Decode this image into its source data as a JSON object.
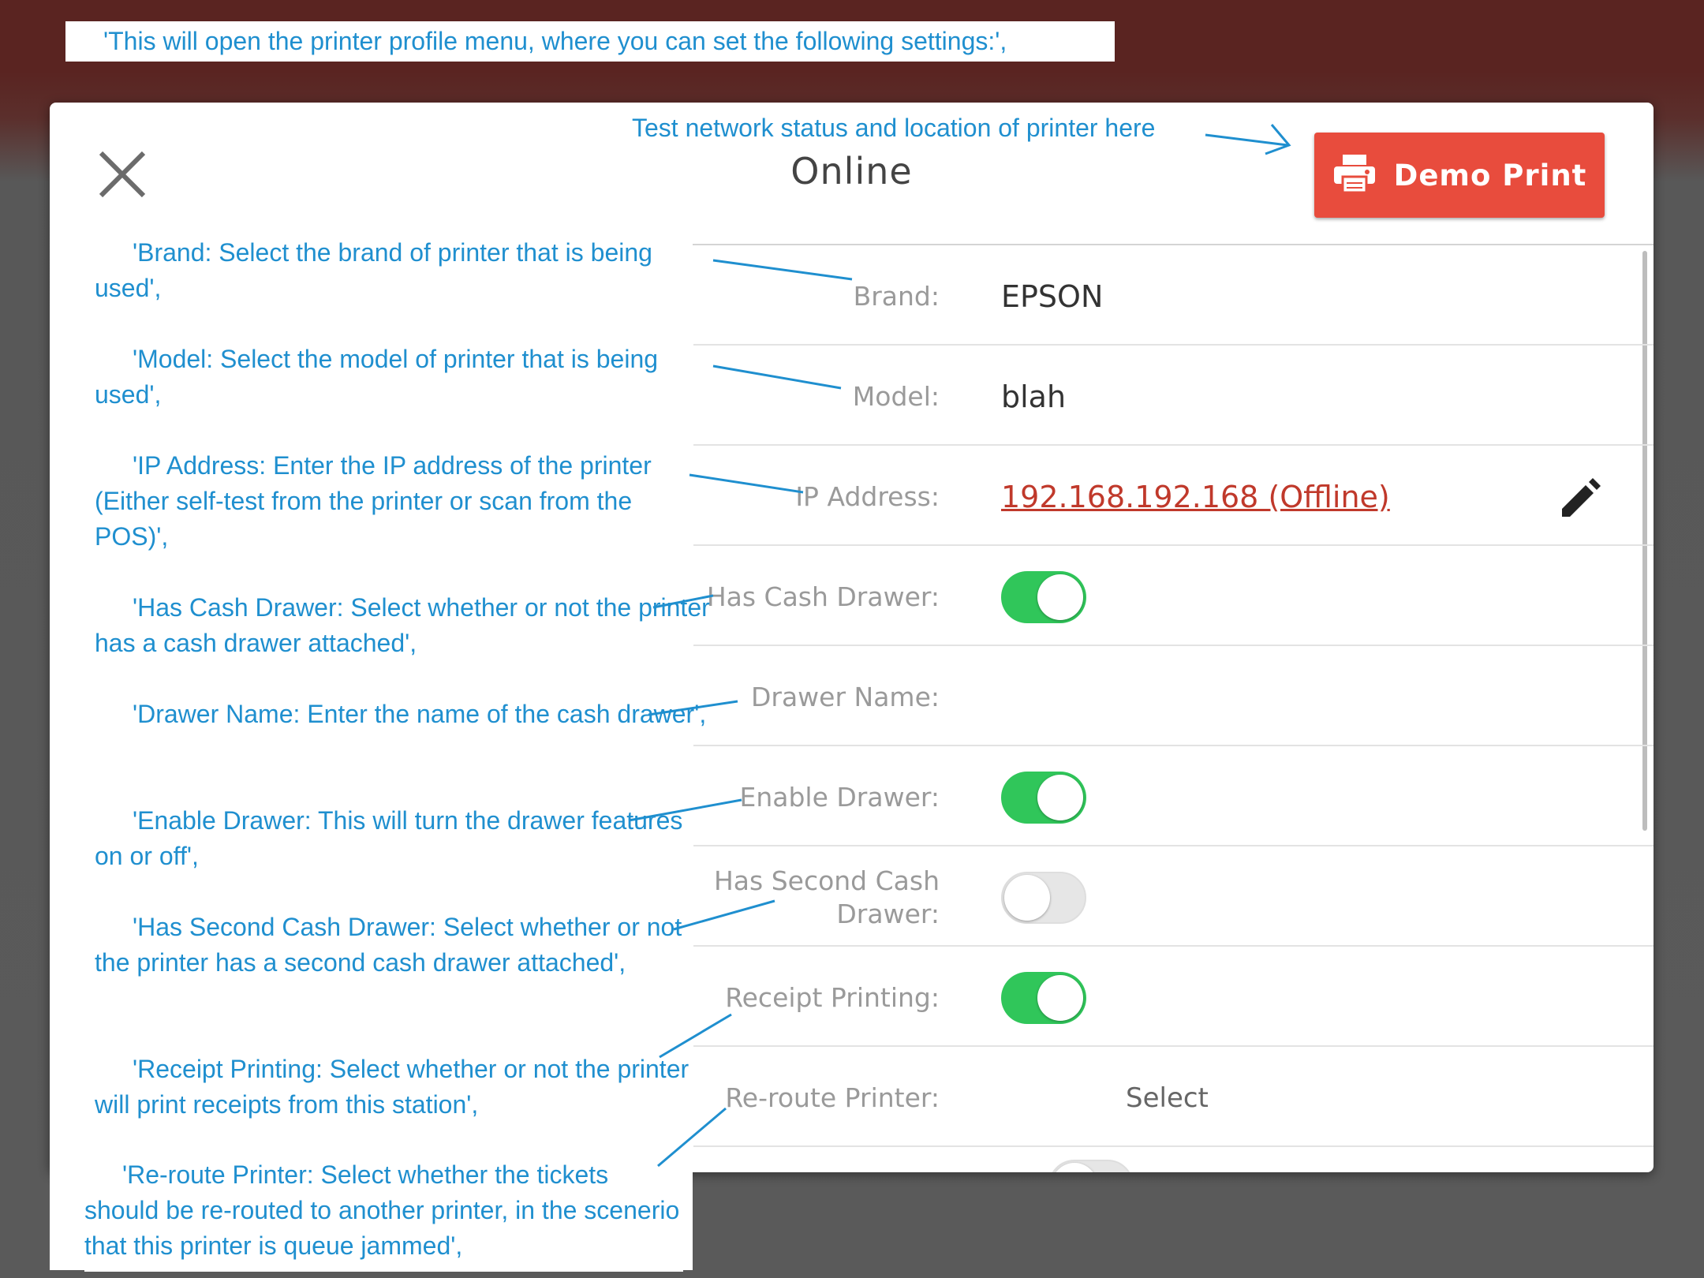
{
  "intro_note": "'This will open the printer profile menu, where you can set the following settings:',",
  "header": {
    "title": "Online",
    "annotation": "Test network status and location of printer here",
    "demo_button_label": "Demo Print"
  },
  "fields": {
    "brand": {
      "label": "Brand:",
      "value": "EPSON"
    },
    "model": {
      "label": "Model:",
      "value": "blah"
    },
    "ip_address": {
      "label": "IP Address:",
      "value": "192.168.192.168 (Offline)"
    },
    "has_cash_drawer": {
      "label": "Has Cash Drawer:",
      "enabled": true
    },
    "drawer_name": {
      "label": "Drawer Name:",
      "value": ""
    },
    "enable_drawer": {
      "label": "Enable Drawer:",
      "enabled": true
    },
    "has_second_cash_drawer": {
      "label": "Has Second Cash Drawer:",
      "enabled": false
    },
    "receipt_printing": {
      "label": "Receipt Printing:",
      "enabled": true
    },
    "reroute_printer": {
      "label": "Re-route Printer:",
      "value": "Select"
    }
  },
  "notes": {
    "brand": "'Brand: Select the brand of printer that is being used',",
    "model": "'Model: Select the model of printer that is being used',",
    "ip_address": "'IP Address: Enter the IP address of the printer (Either self-test from the printer or scan from the POS)',",
    "has_cash_drawer": "'Has Cash Drawer: Select whether or not the printer has a cash drawer attached',",
    "drawer_name": "'Drawer Name: Enter the name of the cash drawer',",
    "enable_drawer": "'Enable Drawer: This will turn the drawer features on or off',",
    "has_second_cash_drawer": "'Has Second Cash Drawer: Select whether or not the printer has a second cash drawer attached',",
    "receipt_printing": "'Receipt Printing: Select whether or not the printer will print receipts from this station',",
    "reroute_printer": "'Re-route Printer: Select whether the tickets should be re-routed to another printer, in the scenerio that this printer is queue jammed',"
  },
  "colors": {
    "annotation_blue": "#1f8fcf",
    "demo_button_red": "#e84c3d",
    "toggle_green": "#30c65a",
    "offline_link_red": "#c0392b"
  },
  "icons": [
    "close-icon",
    "printer-icon",
    "pencil-edit-icon"
  ]
}
